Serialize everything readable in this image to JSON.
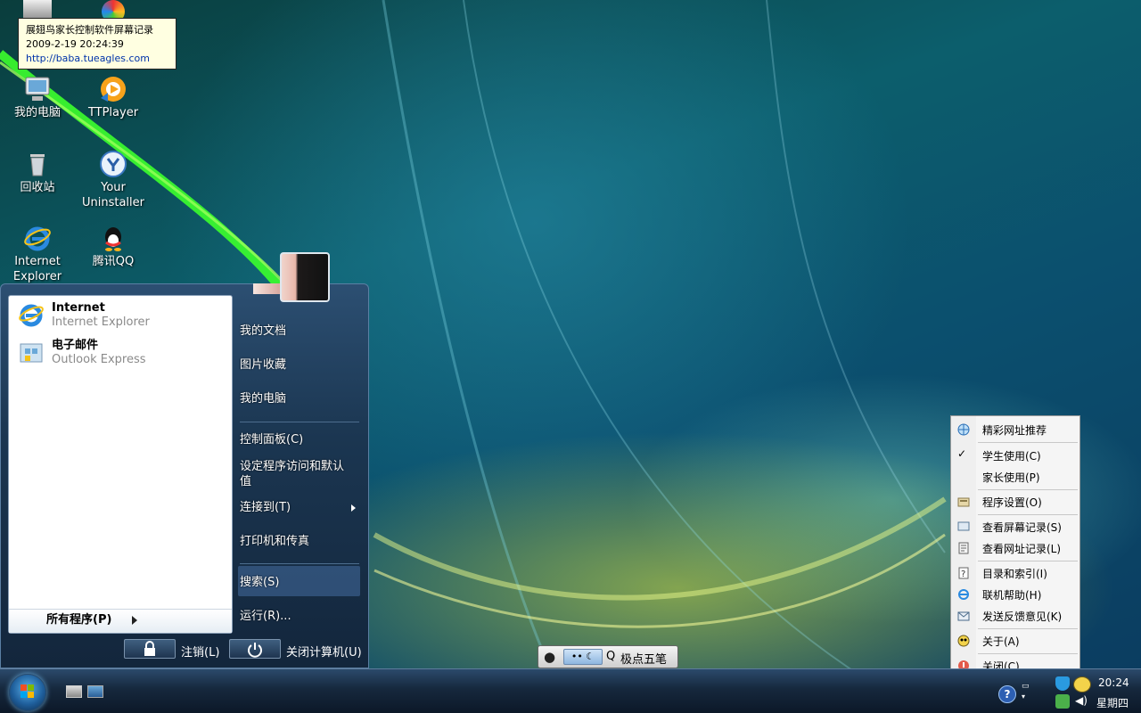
{
  "tooltip": {
    "title": "展翅鸟家长控制软件屏幕记录",
    "datetime": "2009-2-19 20:24:39",
    "link": "http://baba.tueagles.com"
  },
  "desktop_icons": [
    {
      "label": "我的电脑",
      "icon": "my-computer-icon"
    },
    {
      "label": "TTPlayer",
      "icon": "ttplayer-icon"
    },
    {
      "label": "回收站",
      "icon": "recycle-bin-icon"
    },
    {
      "label": "Your Uninstaller",
      "icon": "uninstaller-icon"
    },
    {
      "label": "Internet Explorer",
      "icon": "internet-explorer-icon"
    },
    {
      "label": "腾讯QQ",
      "icon": "qq-icon"
    }
  ],
  "start_menu": {
    "pinned": [
      {
        "title": "Internet",
        "subtitle": "Internet Explorer",
        "icon": "internet-explorer-icon"
      },
      {
        "title": "电子邮件",
        "subtitle": "Outlook Express",
        "icon": "outlook-express-icon"
      }
    ],
    "all_programs": "所有程序(P)",
    "right_items": [
      "我的文档",
      "图片收藏",
      "我的电脑",
      "控制面板(C)",
      "设定程序访问和默认值",
      "连接到(T)",
      "打印机和传真",
      "搜索(S)",
      "运行(R)..."
    ],
    "logoff": "注销(L)",
    "shutdown": "关闭计算机(U)"
  },
  "context_menu": {
    "items": [
      {
        "label": "精彩网址推荐",
        "icon": "globe-icon",
        "checked": false
      },
      {
        "label": "学生使用(C)",
        "icon": "",
        "checked": true
      },
      {
        "label": "家长使用(P)",
        "icon": "",
        "checked": false
      },
      {
        "label": "程序设置(O)",
        "icon": "settings-icon",
        "checked": false
      },
      {
        "label": "查看屏幕记录(S)",
        "icon": "screen-record-icon",
        "checked": false
      },
      {
        "label": "查看网址记录(L)",
        "icon": "url-record-icon",
        "checked": false
      },
      {
        "label": "目录和索引(I)",
        "icon": "help-index-icon",
        "checked": false
      },
      {
        "label": "联机帮助(H)",
        "icon": "online-help-icon",
        "checked": false
      },
      {
        "label": "发送反馈意见(K)",
        "icon": "feedback-icon",
        "checked": false
      },
      {
        "label": "关于(A)",
        "icon": "about-icon",
        "checked": false
      },
      {
        "label": "关闭(C)",
        "icon": "close-icon",
        "checked": false
      }
    ]
  },
  "ime_bar": {
    "label": "极点五笔"
  },
  "taskbar": {
    "time": "20:24",
    "day": "星期四"
  },
  "colors": {
    "taskbar": "#16283d",
    "start_menu": "#1b3651",
    "tooltip": "#ffffe1"
  }
}
